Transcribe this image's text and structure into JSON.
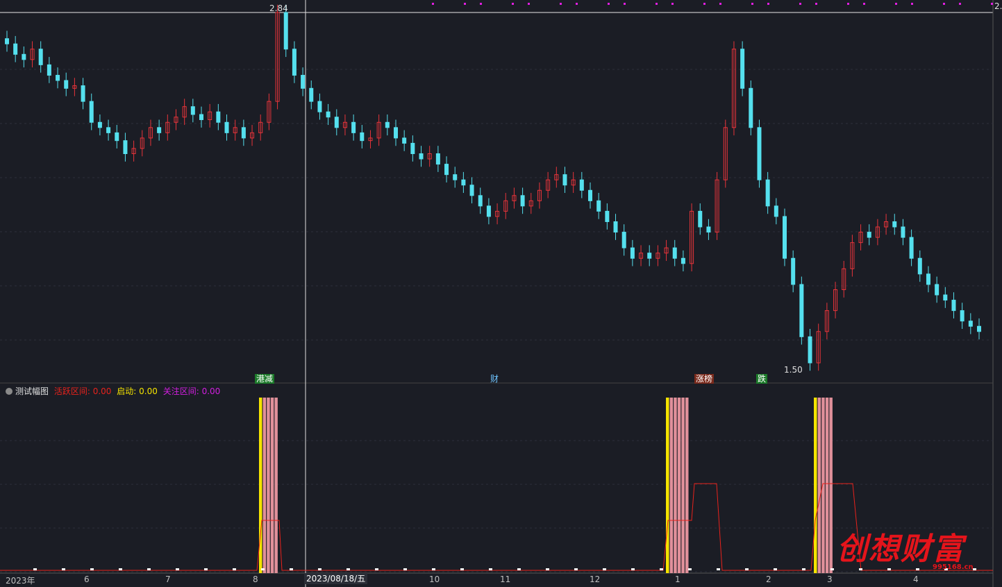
{
  "chart_data": {
    "type": "candlestick",
    "title": "",
    "price_high_label": "2.84",
    "price_low_label": "1.50",
    "axis_right_label": "2.",
    "x_ticks": [
      "2023年",
      "6",
      "7",
      "8",
      "10",
      "11",
      "12",
      "1",
      "2",
      "3",
      "4"
    ],
    "crosshair_date": "2023/08/18/五",
    "event_tags": [
      {
        "text": "港减",
        "style": "green"
      },
      {
        "text": "财",
        "style": "blue"
      },
      {
        "text": "涨榜",
        "style": "red"
      },
      {
        "text": "跌",
        "style": "green"
      }
    ],
    "close_series": [
      2.72,
      2.68,
      2.66,
      2.7,
      2.64,
      2.6,
      2.58,
      2.55,
      2.56,
      2.5,
      2.42,
      2.4,
      2.38,
      2.35,
      2.3,
      2.32,
      2.36,
      2.4,
      2.38,
      2.42,
      2.44,
      2.48,
      2.45,
      2.43,
      2.46,
      2.42,
      2.38,
      2.4,
      2.36,
      2.38,
      2.42,
      2.5,
      2.84,
      2.7,
      2.6,
      2.55,
      2.5,
      2.46,
      2.44,
      2.4,
      2.42,
      2.38,
      2.35,
      2.36,
      2.42,
      2.4,
      2.36,
      2.34,
      2.3,
      2.28,
      2.3,
      2.26,
      2.22,
      2.2,
      2.18,
      2.14,
      2.1,
      2.06,
      2.08,
      2.12,
      2.14,
      2.1,
      2.12,
      2.16,
      2.2,
      2.22,
      2.18,
      2.2,
      2.16,
      2.12,
      2.08,
      2.04,
      2.0,
      1.94,
      1.9,
      1.92,
      1.9,
      1.92,
      1.94,
      1.9,
      1.88,
      2.08,
      2.02,
      2.0,
      2.2,
      2.4,
      2.7,
      2.55,
      2.4,
      2.2,
      2.1,
      2.06,
      1.9,
      1.8,
      1.6,
      1.5,
      1.62,
      1.7,
      1.78,
      1.86,
      1.96,
      2.0,
      1.98,
      2.02,
      2.04,
      2.02,
      1.98,
      1.9,
      1.84,
      1.8,
      1.76,
      1.74,
      1.7,
      1.66,
      1.64,
      1.62
    ]
  },
  "indicator": {
    "name": "测试幅图",
    "fields": [
      {
        "label": "活跃区间:",
        "value": "0.00",
        "color": "#e8221c"
      },
      {
        "label": "启动:",
        "value": "0.00",
        "color": "#f5e400"
      },
      {
        "label": "关注区间:",
        "value": "0.00",
        "color": "#d21ee0"
      }
    ],
    "bar_groups": [
      {
        "bars": [
          "yellow",
          "pink",
          "pink",
          "pink",
          "pink"
        ]
      },
      {
        "bars": [
          "yellow",
          "pink",
          "pink",
          "pink",
          "pink",
          "pink"
        ]
      },
      {
        "bars": [
          "yellow",
          "pink",
          "pink",
          "pink",
          "pink"
        ]
      }
    ]
  },
  "colors": {
    "background": "#1b1d25",
    "up": "#e8343a",
    "down": "#55e0ee",
    "grid": "#2c303b",
    "marker": "#e01ee0",
    "bar_yellow": "#f5e400",
    "bar_pink": "#e0909a",
    "line_red": "#e8221c"
  },
  "watermark": {
    "text": "创想财富",
    "url": "995168.cn"
  }
}
